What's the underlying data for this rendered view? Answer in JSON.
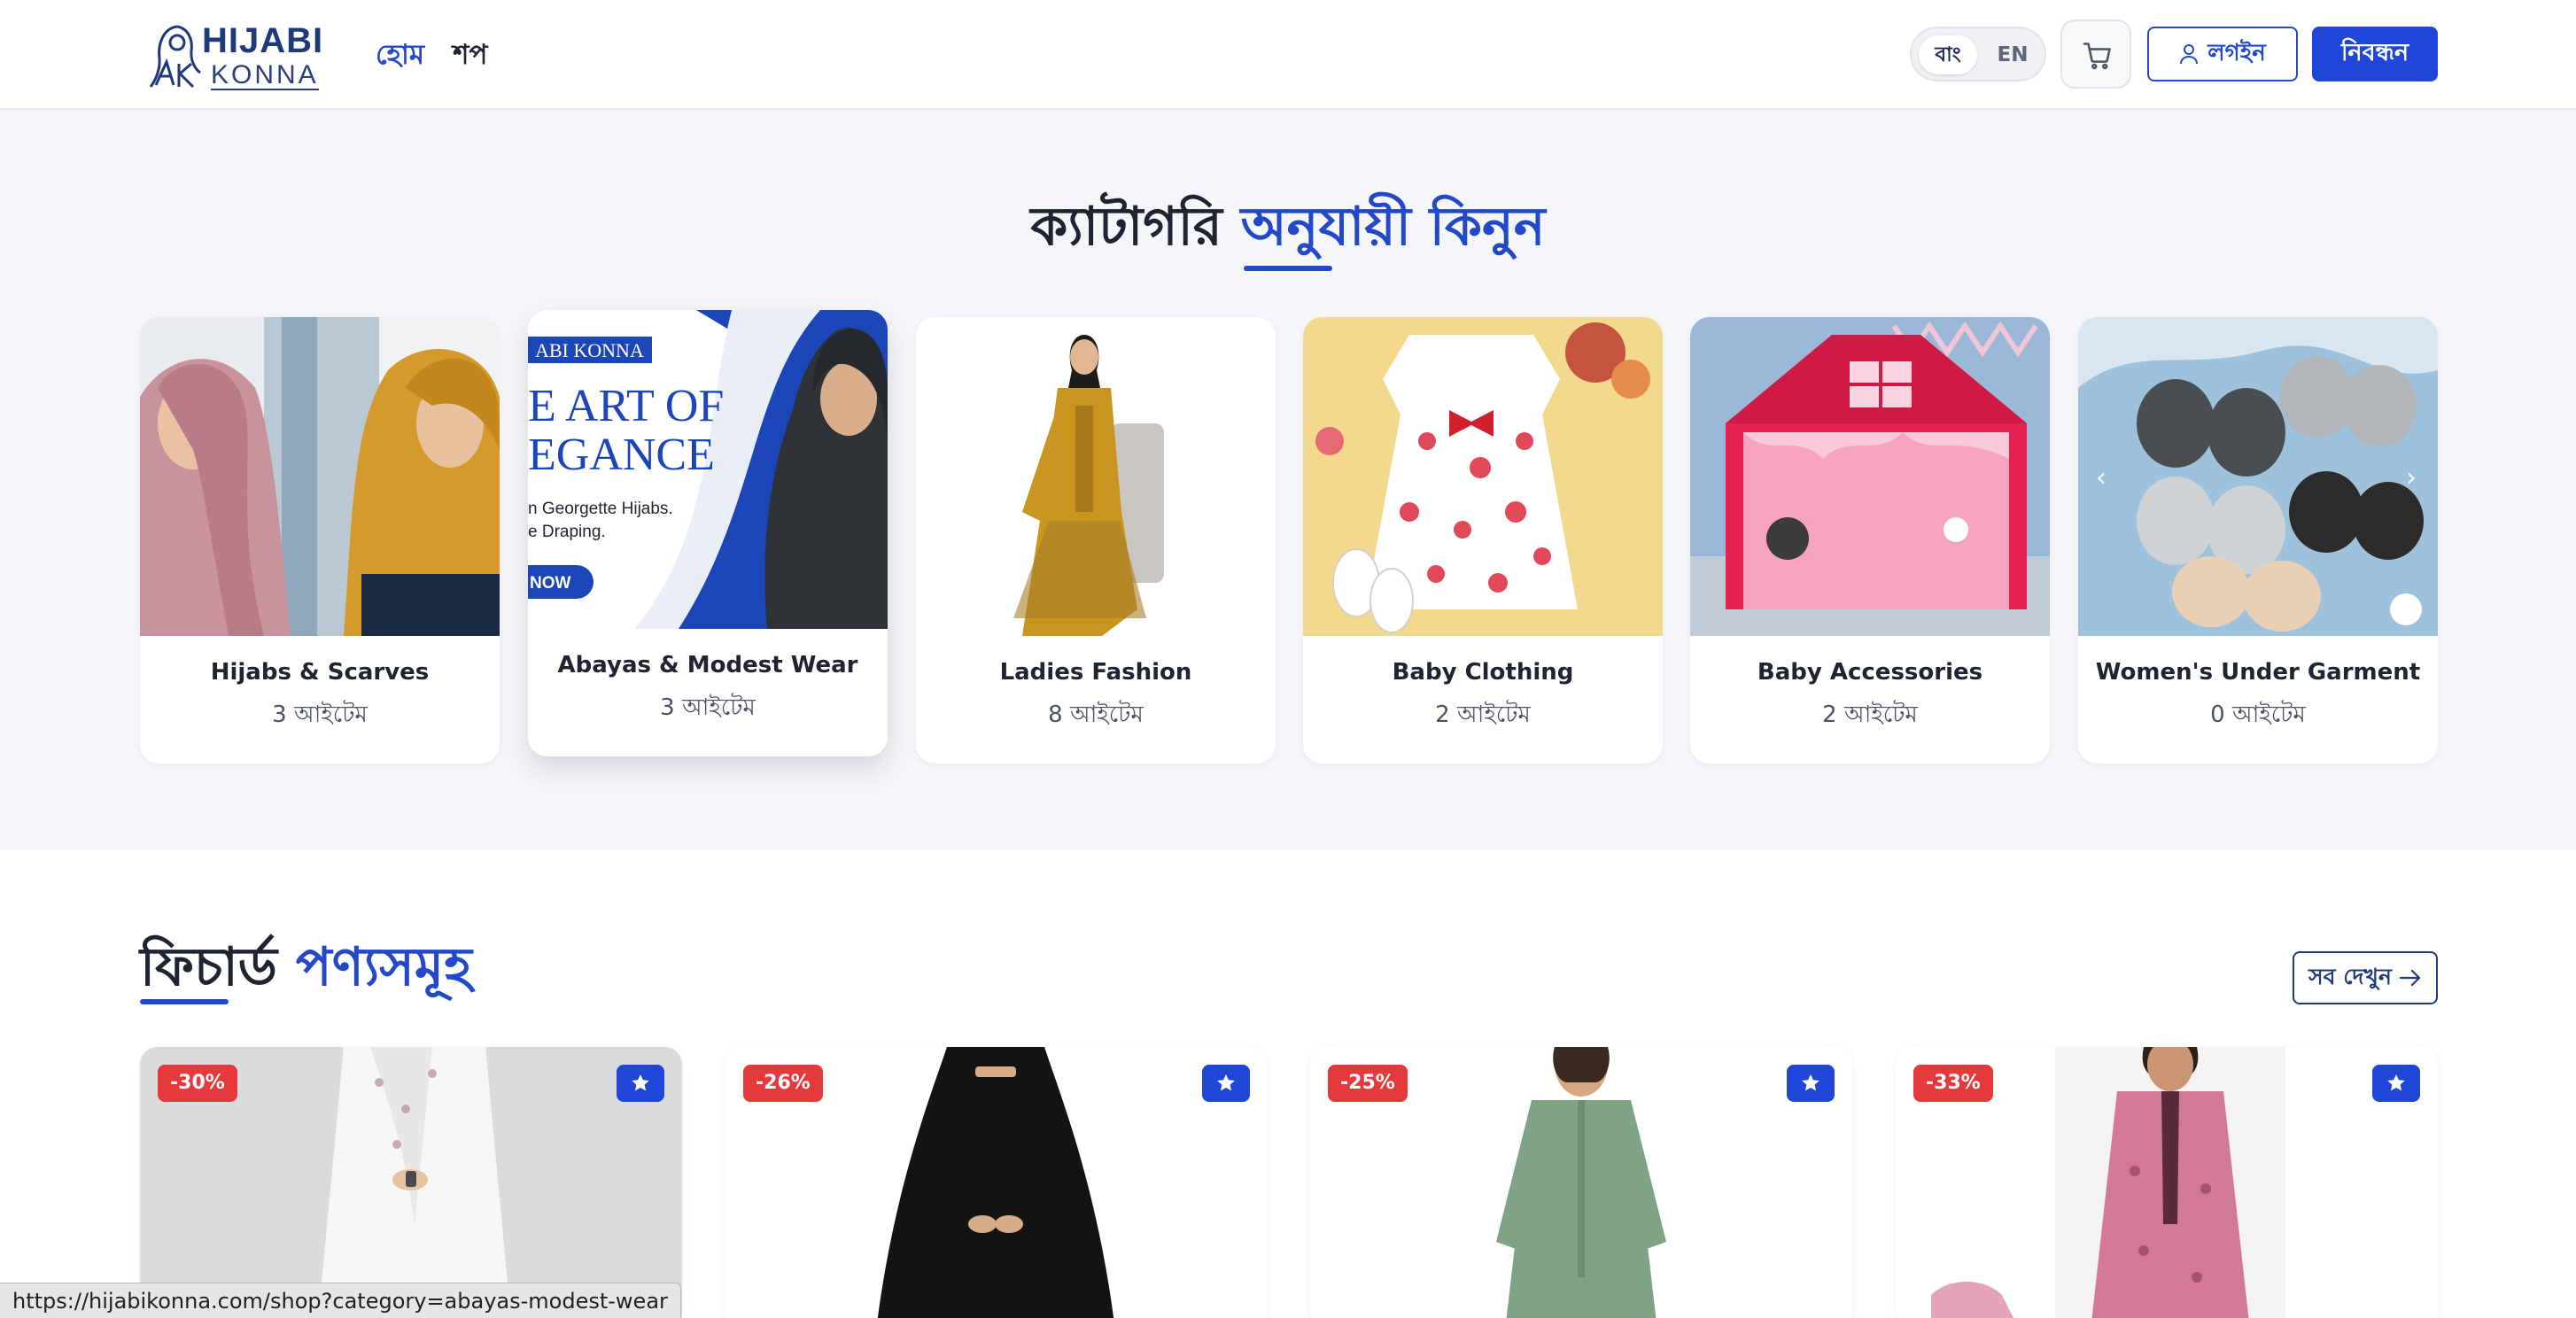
{
  "header": {
    "logo_top": "HIJABI",
    "logo_bottom": "KONNA",
    "nav": [
      "হোম",
      "শপ"
    ],
    "lang_bn": "বাং",
    "lang_en": "EN",
    "login_label": "লগইন",
    "register_label": "নিবন্ধন"
  },
  "categories": {
    "title_main": "ক্যাটাগরি",
    "title_accent": "অনুযায়ী কিনুন",
    "items": [
      {
        "name": "Hijabs & Scarves",
        "count": "3 আইটেম"
      },
      {
        "name": "Abayas & Modest Wear",
        "count": "3 আইটেম",
        "banner_brand": "ABI KONNA",
        "banner_line1": "E ART OF",
        "banner_line2": "EGANCE",
        "banner_sub1": "n Georgette Hijabs.",
        "banner_sub2": "e Draping.",
        "banner_cta": "NOW"
      },
      {
        "name": "Ladies Fashion",
        "count": "8 আইটেম"
      },
      {
        "name": "Baby Clothing",
        "count": "2 আইটেম"
      },
      {
        "name": "Baby Accessories",
        "count": "2 আইটেম"
      },
      {
        "name": "Women's Under Garment",
        "count": "0 আইটেম"
      }
    ]
  },
  "featured": {
    "title_main": "ফিচার্ড",
    "title_accent": "পণ্যসমূহ",
    "see_all": "সব দেখুন",
    "products": [
      {
        "discount": "-30%"
      },
      {
        "discount": "-26%"
      },
      {
        "discount": "-25%"
      },
      {
        "discount": "-33%"
      }
    ]
  },
  "status_url": "https://hijabikonna.com/shop?category=abayas-modest-wear",
  "colors": {
    "accent": "#2349c9",
    "button_blue": "#1f46d6",
    "discount_red": "#e5393b",
    "page_bg": "#f5f6f9"
  },
  "icons": [
    "cart-icon",
    "user-icon",
    "star-icon",
    "arrow-right-icon",
    "chevron-left-icon",
    "chevron-right-icon"
  ]
}
